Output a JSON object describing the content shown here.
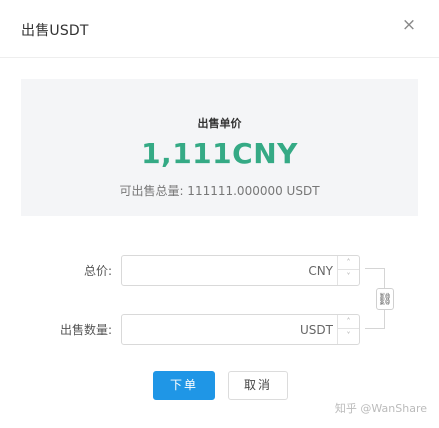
{
  "dialog": {
    "title": "出售USDT",
    "close_symbol": "×"
  },
  "summary": {
    "unit_price_label": "出售单价",
    "unit_price": "1,111CNY",
    "sell_total_text": "可出售总量:  111111.000000 USDT"
  },
  "form": {
    "total": {
      "label": "总价:",
      "value": "",
      "unit": "CNY"
    },
    "quantity": {
      "label": "出售数量:",
      "value": "",
      "unit": "USDT"
    },
    "stepper_up": "˄",
    "stepper_down": "˅",
    "link_symbol": "⛓"
  },
  "buttons": {
    "submit_label": "下单",
    "cancel_label": "取消"
  },
  "watermark": "知乎 @WanShare",
  "colors": {
    "accent_green": "#35aa85",
    "primary_blue": "#1f96e6",
    "summary_bg": "#f4f5f7"
  }
}
